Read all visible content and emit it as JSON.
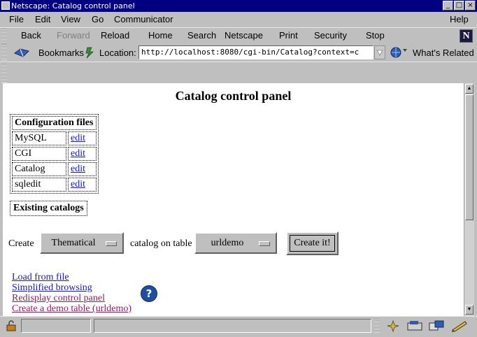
{
  "window": {
    "title": "Netscape: Catalog control panel"
  },
  "menu": {
    "file": "File",
    "edit": "Edit",
    "view": "View",
    "go": "Go",
    "communicator": "Communicator",
    "help": "Help"
  },
  "toolbar": {
    "back": "Back",
    "forward": "Forward",
    "reload": "Reload",
    "home": "Home",
    "search": "Search",
    "netscape": "Netscape",
    "print": "Print",
    "security": "Security",
    "stop": "Stop",
    "brand_letter": "N"
  },
  "location": {
    "bookmarks": "Bookmarks",
    "label": "Location:",
    "url": "http://localhost:8080/cgi-bin/Catalog?context=c",
    "whats_related": "What's Related"
  },
  "page": {
    "title": "Catalog control panel",
    "config_header": "Configuration files",
    "config_rows": [
      {
        "name": "MySQL",
        "action": "edit"
      },
      {
        "name": "CGI",
        "action": "edit"
      },
      {
        "name": "Catalog",
        "action": "edit"
      },
      {
        "name": "sqledit",
        "action": "edit"
      }
    ],
    "existing_header": "Existing catalogs",
    "create_label": "Create",
    "catalog_type": "Thematical",
    "on_table_label": "catalog on table",
    "table_name": "urldemo",
    "create_button": "Create it!",
    "links": {
      "load": "Load from file",
      "simplified": "Simplified browsing",
      "redisplay": "Redisplay control panel",
      "demo": "Create a demo table (urldemo)"
    },
    "help_glyph": "?"
  }
}
